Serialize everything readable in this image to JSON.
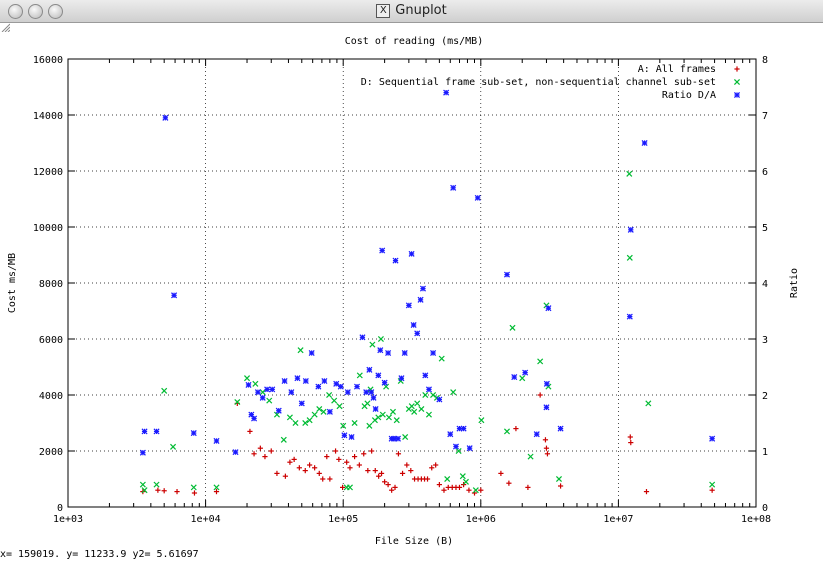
{
  "window": {
    "title": "Gnuplot"
  },
  "status_text": "x= 159019. y= 11233.9 y2= 5.61697",
  "chart_data": {
    "type": "scatter",
    "title": "Cost of reading (ms/MB)",
    "xlabel": "File Size (B)",
    "ylabel": "Cost ms/MB",
    "y2label": "Ratio",
    "x_scale": "log",
    "xlim": [
      1000,
      100000000
    ],
    "ylim": [
      0,
      16000
    ],
    "y2lim": [
      0,
      8
    ],
    "grid": true,
    "legend_position": "top-right",
    "x_ticks": [
      "1e+03",
      "1e+04",
      "1e+05",
      "1e+06",
      "1e+07",
      "1e+08"
    ],
    "y_ticks": [
      "0",
      "2000",
      "4000",
      "6000",
      "8000",
      "10000",
      "12000",
      "14000",
      "16000"
    ],
    "y2_ticks": [
      "0",
      "1",
      "2",
      "3",
      "4",
      "5",
      "6",
      "7",
      "8"
    ],
    "series": [
      {
        "name": "A: All frames",
        "marker": "+",
        "color": "#cc0000",
        "axis": "y",
        "points": [
          [
            3500,
            550
          ],
          [
            4500,
            600
          ],
          [
            5000,
            580
          ],
          [
            6200,
            550
          ],
          [
            8300,
            500
          ],
          [
            12000,
            550
          ],
          [
            17000,
            3700
          ],
          [
            21000,
            2700
          ],
          [
            22500,
            1900
          ],
          [
            25000,
            2100
          ],
          [
            27000,
            1800
          ],
          [
            30000,
            2000
          ],
          [
            33000,
            1200
          ],
          [
            38000,
            1100
          ],
          [
            41000,
            1600
          ],
          [
            44000,
            1700
          ],
          [
            48000,
            1400
          ],
          [
            53000,
            1300
          ],
          [
            57000,
            1500
          ],
          [
            62000,
            1400
          ],
          [
            67000,
            1200
          ],
          [
            71000,
            1000
          ],
          [
            76000,
            1800
          ],
          [
            80000,
            1000
          ],
          [
            88000,
            2000
          ],
          [
            93000,
            1700
          ],
          [
            99000,
            700
          ],
          [
            106000,
            1600
          ],
          [
            112000,
            1400
          ],
          [
            121000,
            1800
          ],
          [
            131000,
            1500
          ],
          [
            141000,
            1900
          ],
          [
            151000,
            1300
          ],
          [
            161000,
            2000
          ],
          [
            171000,
            1300
          ],
          [
            181000,
            1100
          ],
          [
            190000,
            1200
          ],
          [
            200000,
            900
          ],
          [
            212000,
            800
          ],
          [
            225000,
            600
          ],
          [
            238000,
            700
          ],
          [
            252000,
            1900
          ],
          [
            270000,
            1200
          ],
          [
            290000,
            1500
          ],
          [
            310000,
            1300
          ],
          [
            330000,
            1000
          ],
          [
            350000,
            1000
          ],
          [
            370000,
            1000
          ],
          [
            390000,
            1000
          ],
          [
            410000,
            1000
          ],
          [
            440000,
            1400
          ],
          [
            470000,
            1500
          ],
          [
            500000,
            800
          ],
          [
            540000,
            600
          ],
          [
            580000,
            700
          ],
          [
            620000,
            700
          ],
          [
            660000,
            700
          ],
          [
            700000,
            700
          ],
          [
            750000,
            800
          ],
          [
            820000,
            600
          ],
          [
            900000,
            500
          ],
          [
            1000000,
            600
          ],
          [
            1400000,
            1200
          ],
          [
            1600000,
            850
          ],
          [
            1800000,
            2800
          ],
          [
            2200000,
            700
          ],
          [
            2700000,
            4000
          ],
          [
            2950000,
            2400
          ],
          [
            3000000,
            2100
          ],
          [
            3050000,
            1900
          ],
          [
            3800000,
            750
          ],
          [
            12200000,
            2500
          ],
          [
            12300000,
            2300
          ],
          [
            16000000,
            550
          ],
          [
            48000000,
            600
          ]
        ]
      },
      {
        "name": "D: Sequential frame sub-set, non-sequential channel sub-set",
        "marker": "x",
        "color": "#00bb33",
        "axis": "y",
        "points": [
          [
            3500,
            800
          ],
          [
            3600,
            600
          ],
          [
            4400,
            800
          ],
          [
            5000,
            4150
          ],
          [
            5800,
            2150
          ],
          [
            8200,
            700
          ],
          [
            12000,
            700
          ],
          [
            17000,
            3750
          ],
          [
            20000,
            4600
          ],
          [
            23000,
            4400
          ],
          [
            26000,
            4100
          ],
          [
            29000,
            3800
          ],
          [
            33000,
            3300
          ],
          [
            37000,
            2400
          ],
          [
            41000,
            3200
          ],
          [
            45000,
            3000
          ],
          [
            49000,
            5600
          ],
          [
            53000,
            3000
          ],
          [
            57000,
            3100
          ],
          [
            62000,
            3300
          ],
          [
            67000,
            3500
          ],
          [
            72000,
            3400
          ],
          [
            79000,
            4000
          ],
          [
            86000,
            3800
          ],
          [
            94000,
            3600
          ],
          [
            100000,
            2900
          ],
          [
            106000,
            700
          ],
          [
            112000,
            700
          ],
          [
            121000,
            3000
          ],
          [
            132000,
            4700
          ],
          [
            143000,
            3600
          ],
          [
            150000,
            3700
          ],
          [
            155000,
            2900
          ],
          [
            158000,
            4200
          ],
          [
            163000,
            5800
          ],
          [
            170000,
            3100
          ],
          [
            180000,
            3200
          ],
          [
            188000,
            6000
          ],
          [
            194000,
            3300
          ],
          [
            205000,
            4300
          ],
          [
            215000,
            3200
          ],
          [
            230000,
            3400
          ],
          [
            245000,
            3100
          ],
          [
            262000,
            4500
          ],
          [
            282000,
            2500
          ],
          [
            300000,
            3500
          ],
          [
            315000,
            3600
          ],
          [
            328000,
            3400
          ],
          [
            345000,
            3700
          ],
          [
            370000,
            3500
          ],
          [
            395000,
            4000
          ],
          [
            420000,
            3300
          ],
          [
            450000,
            4000
          ],
          [
            480000,
            3900
          ],
          [
            520000,
            5300
          ],
          [
            570000,
            1000
          ],
          [
            630000,
            4100
          ],
          [
            690000,
            2000
          ],
          [
            740000,
            1100
          ],
          [
            780000,
            900
          ],
          [
            920000,
            600
          ],
          [
            1010000,
            3100
          ],
          [
            1550000,
            2700
          ],
          [
            1700000,
            6400
          ],
          [
            2000000,
            4600
          ],
          [
            2300000,
            1800
          ],
          [
            2700000,
            5200
          ],
          [
            3000000,
            7200
          ],
          [
            3100000,
            4300
          ],
          [
            3700000,
            1000
          ],
          [
            12000000,
            11900
          ],
          [
            12100000,
            8900
          ],
          [
            16500000,
            3700
          ],
          [
            48000000,
            800
          ]
        ]
      },
      {
        "name": "Ratio D/A",
        "marker": "*",
        "color": "#1a1aff",
        "axis": "y2",
        "points": [
          [
            3500,
            0.97
          ],
          [
            3600,
            1.35
          ],
          [
            4400,
            1.35
          ],
          [
            5100,
            6.95
          ],
          [
            5900,
            3.78
          ],
          [
            8200,
            1.32
          ],
          [
            12000,
            1.18
          ],
          [
            16500,
            0.98
          ],
          [
            20500,
            2.18
          ],
          [
            21500,
            1.65
          ],
          [
            22500,
            1.58
          ],
          [
            24000,
            2.05
          ],
          [
            26000,
            1.95
          ],
          [
            28000,
            2.1
          ],
          [
            30500,
            2.1
          ],
          [
            34000,
            1.72
          ],
          [
            37500,
            2.25
          ],
          [
            42000,
            2.05
          ],
          [
            46500,
            2.3
          ],
          [
            50000,
            1.85
          ],
          [
            53500,
            2.25
          ],
          [
            59000,
            2.75
          ],
          [
            66000,
            2.15
          ],
          [
            73000,
            2.25
          ],
          [
            80000,
            1.7
          ],
          [
            89000,
            2.2
          ],
          [
            96000,
            2.15
          ],
          [
            102000,
            1.28
          ],
          [
            108000,
            2.05
          ],
          [
            115000,
            1.25
          ],
          [
            126000,
            2.15
          ],
          [
            138000,
            3.03
          ],
          [
            147000,
            2.05
          ],
          [
            155000,
            2.45
          ],
          [
            160000,
            2.05
          ],
          [
            166000,
            1.95
          ],
          [
            172000,
            1.75
          ],
          [
            180000,
            2.35
          ],
          [
            186000,
            2.8
          ],
          [
            192000,
            4.58
          ],
          [
            200000,
            2.22
          ],
          [
            212000,
            2.75
          ],
          [
            225000,
            1.22
          ],
          [
            235000,
            1.22
          ],
          [
            240000,
            4.4
          ],
          [
            250000,
            1.22
          ],
          [
            265000,
            2.3
          ],
          [
            280000,
            2.75
          ],
          [
            300000,
            3.6
          ],
          [
            314000,
            4.52
          ],
          [
            325000,
            3.25
          ],
          [
            345000,
            3.1
          ],
          [
            365000,
            3.7
          ],
          [
            380000,
            3.9
          ],
          [
            395000,
            2.35
          ],
          [
            420000,
            2.1
          ],
          [
            450000,
            2.75
          ],
          [
            500000,
            1.92
          ],
          [
            560000,
            7.4
          ],
          [
            600000,
            1.3
          ],
          [
            630000,
            5.7
          ],
          [
            660000,
            1.08
          ],
          [
            700000,
            1.4
          ],
          [
            750000,
            1.4
          ],
          [
            830000,
            1.05
          ],
          [
            950000,
            5.52
          ],
          [
            1550000,
            4.15
          ],
          [
            1750000,
            2.32
          ],
          [
            2100000,
            2.4
          ],
          [
            2550000,
            1.3
          ],
          [
            3000000,
            1.78
          ],
          [
            3020000,
            2.2
          ],
          [
            3100000,
            3.55
          ],
          [
            3800000,
            1.4
          ],
          [
            12100000,
            3.4
          ],
          [
            12300000,
            4.95
          ],
          [
            15500000,
            6.5
          ],
          [
            48000000,
            1.22
          ]
        ]
      }
    ]
  }
}
